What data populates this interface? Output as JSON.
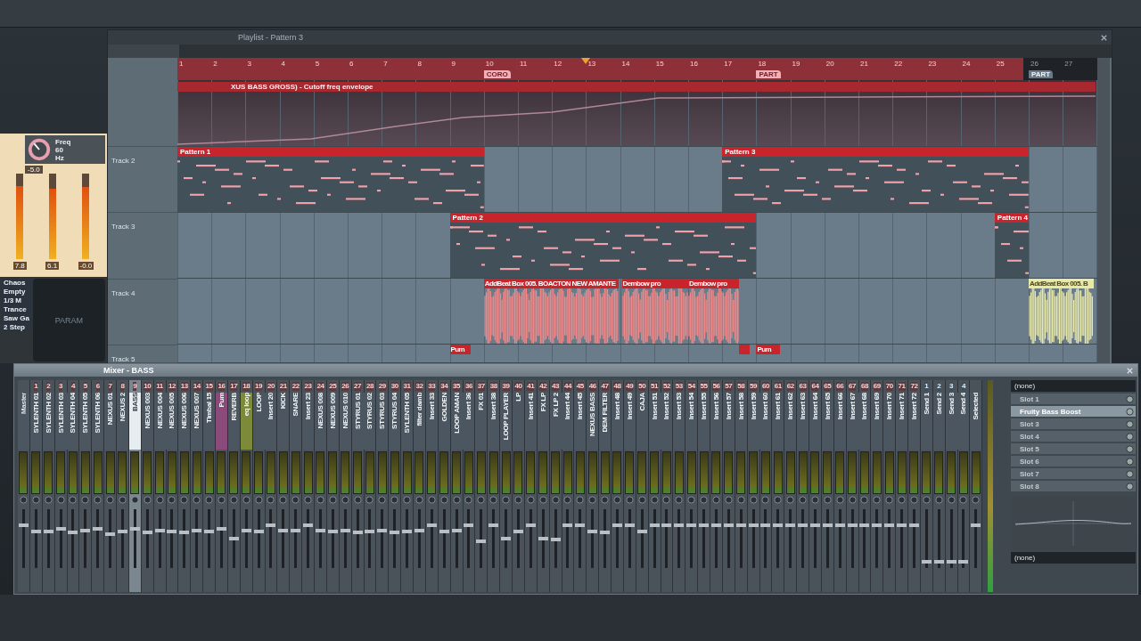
{
  "playlist": {
    "title": "Playlist - Pattern 3",
    "ruler": [
      {
        "label": "1",
        "in_song": true
      },
      {
        "label": "2",
        "in_song": true
      },
      {
        "label": "3",
        "in_song": true
      },
      {
        "label": "4",
        "in_song": true
      },
      {
        "label": "5",
        "in_song": true
      },
      {
        "label": "6",
        "in_song": true
      },
      {
        "label": "7",
        "in_song": true
      },
      {
        "label": "8",
        "in_song": true
      },
      {
        "label": "9",
        "in_song": true
      },
      {
        "label": "10",
        "in_song": true
      },
      {
        "label": "11",
        "in_song": true
      },
      {
        "label": "12",
        "in_song": true
      },
      {
        "label": "13",
        "in_song": true
      },
      {
        "label": "14",
        "in_song": true
      },
      {
        "label": "15",
        "in_song": true
      },
      {
        "label": "16",
        "in_song": true
      },
      {
        "label": "17",
        "in_song": true
      },
      {
        "label": "18",
        "in_song": true
      },
      {
        "label": "19",
        "in_song": true
      },
      {
        "label": "20",
        "in_song": true
      },
      {
        "label": "21",
        "in_song": true
      },
      {
        "label": "22",
        "in_song": true
      },
      {
        "label": "23",
        "in_song": true
      },
      {
        "label": "24",
        "in_song": true
      },
      {
        "label": "25",
        "in_song": true
      },
      {
        "label": "26",
        "in_song": false
      },
      {
        "label": "27",
        "in_song": false
      }
    ],
    "markers": [
      {
        "label": "CORO",
        "in_song": true
      },
      {
        "label": "PART",
        "in_song": true
      },
      {
        "label": "PART",
        "in_song": false
      }
    ],
    "automation": {
      "title": "XUS BASS GROSS) - Cutoff freq envelope"
    },
    "tracks": [
      {
        "name": "Track 2",
        "clips": [
          {
            "kind": "pattern",
            "title": "Pattern 1"
          },
          {
            "kind": "pattern",
            "title": "Pattern 3"
          }
        ]
      },
      {
        "name": "Track 3",
        "clips": [
          {
            "kind": "pattern",
            "title": "Pattern 2"
          },
          {
            "kind": "pattern",
            "title": "Pattern 4"
          }
        ]
      },
      {
        "name": "Track 4",
        "clips": [
          {
            "kind": "audio",
            "title": "AddBeat Box 005. BOACTON NEW AMANTE",
            "color": "#c8242c"
          },
          {
            "kind": "audio",
            "title": "Dembow pro",
            "color": "#c8242c"
          },
          {
            "kind": "audio",
            "title": "Dembow pro",
            "color": "#c8242c"
          },
          {
            "kind": "audio",
            "title": "AddBeat Box 005. B",
            "color": "#e8e8a8"
          }
        ]
      },
      {
        "name": "Track 5",
        "clips": [
          {
            "kind": "audio",
            "title": "Pum",
            "color": "#c8242c"
          },
          {
            "kind": "audio",
            "color": "#c8242c"
          },
          {
            "kind": "audio",
            "title": "Pum",
            "color": "#c8242c"
          }
        ]
      }
    ]
  },
  "plugin": {
    "knob_label": "Freq",
    "knob_value": "60",
    "knob_unit": "Hz",
    "readout": "-5.0",
    "meters": [
      {
        "value": "7.8",
        "level": 0.85
      },
      {
        "value": "6.1",
        "level": 0.82
      },
      {
        "value": "-0.0",
        "level": 0.84
      }
    ],
    "presets": [
      "Chaos",
      "Empty",
      "1/3 M",
      "Trance",
      "Saw Ga",
      "2 Step"
    ],
    "display": "PARAM"
  },
  "mixer": {
    "title": "Mixer - BASS",
    "strips": [
      {
        "kind": "master",
        "name": "Master",
        "selected": false,
        "color": "#4c5660",
        "level": 0.72
      },
      {
        "kind": "insert",
        "number": "1",
        "name": "SYLENTH 01",
        "selected": false,
        "color": "#4c5660",
        "level": 0.62
      },
      {
        "kind": "insert",
        "number": "2",
        "name": "SYLENTH 02",
        "selected": false,
        "color": "#4c5660",
        "level": 0.62
      },
      {
        "kind": "insert",
        "number": "3",
        "name": "SYLENTH 03",
        "selected": false,
        "color": "#4c5660",
        "level": 0.66
      },
      {
        "kind": "insert",
        "number": "4",
        "name": "SYLENTH 04",
        "selected": false,
        "color": "#4c5660",
        "level": 0.6
      },
      {
        "kind": "insert",
        "number": "5",
        "name": "SYLENTH 05",
        "selected": false,
        "color": "#4c5660",
        "level": 0.64
      },
      {
        "kind": "insert",
        "number": "6",
        "name": "SYLENTH 06",
        "selected": false,
        "color": "#4c5660",
        "level": 0.66
      },
      {
        "kind": "insert",
        "number": "7",
        "name": "NEXUS 01",
        "selected": false,
        "color": "#4c5660",
        "level": 0.58
      },
      {
        "kind": "insert",
        "number": "8",
        "name": "NEXUS 2",
        "selected": false,
        "color": "#4c5660",
        "level": 0.62
      },
      {
        "kind": "insert",
        "number": "9",
        "name": "BASS",
        "selected": true,
        "color": "#e6ecf0",
        "level": 0.66
      },
      {
        "kind": "insert",
        "number": "10",
        "name": "NEXUS 003",
        "selected": false,
        "color": "#4c5660",
        "level": 0.6
      },
      {
        "kind": "insert",
        "number": "11",
        "name": "NEXUS 004",
        "selected": false,
        "color": "#4c5660",
        "level": 0.64
      },
      {
        "kind": "insert",
        "number": "12",
        "name": "NEXUS 005",
        "selected": false,
        "color": "#4c5660",
        "level": 0.62
      },
      {
        "kind": "insert",
        "number": "13",
        "name": "NEXUS 006",
        "selected": false,
        "color": "#4c5660",
        "level": 0.6
      },
      {
        "kind": "insert",
        "number": "14",
        "name": "NEXUS 007",
        "selected": false,
        "color": "#4c5660",
        "level": 0.64
      },
      {
        "kind": "insert",
        "number": "15",
        "name": "Timbal 15",
        "selected": false,
        "color": "#4c5660",
        "level": 0.62
      },
      {
        "kind": "insert",
        "number": "16",
        "name": "Pum",
        "selected": false,
        "color": "#8a4a7a",
        "level": 0.66
      },
      {
        "kind": "insert",
        "number": "17",
        "name": "REVERB",
        "selected": false,
        "color": "#4c5660",
        "level": 0.5
      },
      {
        "kind": "insert",
        "number": "18",
        "name": "eq loop",
        "selected": false,
        "color": "#7c8a3a",
        "level": 0.64
      },
      {
        "kind": "insert",
        "number": "19",
        "name": "LOOP",
        "selected": false,
        "color": "#4c5660",
        "level": 0.62
      },
      {
        "kind": "insert",
        "number": "20",
        "name": "Insert 20",
        "selected": false,
        "color": "#4c5660",
        "level": 0.72
      },
      {
        "kind": "insert",
        "number": "21",
        "name": "KICK",
        "selected": false,
        "color": "#4c5660",
        "level": 0.64
      },
      {
        "kind": "insert",
        "number": "22",
        "name": "SNARE",
        "selected": false,
        "color": "#4c5660",
        "level": 0.64
      },
      {
        "kind": "insert",
        "number": "23",
        "name": "Insert 23",
        "selected": false,
        "color": "#4c5660",
        "level": 0.72
      },
      {
        "kind": "insert",
        "number": "24",
        "name": "NEXUS 008",
        "selected": false,
        "color": "#4c5660",
        "level": 0.64
      },
      {
        "kind": "insert",
        "number": "25",
        "name": "NEXUS 009",
        "selected": false,
        "color": "#4c5660",
        "level": 0.62
      },
      {
        "kind": "insert",
        "number": "26",
        "name": "NEXUS 010",
        "selected": false,
        "color": "#4c5660",
        "level": 0.64
      },
      {
        "kind": "insert",
        "number": "27",
        "name": "STYRUS 01",
        "selected": false,
        "color": "#4c5660",
        "level": 0.6
      },
      {
        "kind": "insert",
        "number": "28",
        "name": "STYRUS 02",
        "selected": false,
        "color": "#4c5660",
        "level": 0.62
      },
      {
        "kind": "insert",
        "number": "29",
        "name": "STYRUS 03",
        "selected": false,
        "color": "#4c5660",
        "level": 0.64
      },
      {
        "kind": "insert",
        "number": "30",
        "name": "STYRUS 04",
        "selected": false,
        "color": "#4c5660",
        "level": 0.6
      },
      {
        "kind": "insert",
        "number": "31",
        "name": "SYLENTH 05",
        "selected": false,
        "color": "#4c5660",
        "level": 0.62
      },
      {
        "kind": "insert",
        "number": "32",
        "name": "filter damb",
        "selected": false,
        "color": "#4c5660",
        "level": 0.64
      },
      {
        "kind": "insert",
        "number": "33",
        "name": "Insert 33",
        "selected": false,
        "color": "#4c5660",
        "level": 0.72
      },
      {
        "kind": "insert",
        "number": "34",
        "name": "GOLDEN",
        "selected": false,
        "color": "#4c5660",
        "level": 0.62
      },
      {
        "kind": "insert",
        "number": "35",
        "name": "LOOP AMAN",
        "selected": false,
        "color": "#4c5660",
        "level": 0.64
      },
      {
        "kind": "insert",
        "number": "36",
        "name": "Insert 36",
        "selected": false,
        "color": "#4c5660",
        "level": 0.72
      },
      {
        "kind": "insert",
        "number": "37",
        "name": "FX 01",
        "selected": false,
        "color": "#4c5660",
        "level": 0.46
      },
      {
        "kind": "insert",
        "number": "38",
        "name": "Insert 38",
        "selected": false,
        "color": "#4c5660",
        "level": 0.72
      },
      {
        "kind": "insert",
        "number": "39",
        "name": "LOOP PLAYER",
        "selected": false,
        "color": "#4c5660",
        "level": 0.5
      },
      {
        "kind": "insert",
        "number": "40",
        "name": "LP",
        "selected": false,
        "color": "#4c5660",
        "level": 0.62
      },
      {
        "kind": "insert",
        "number": "41",
        "name": "Insert 41",
        "selected": false,
        "color": "#4c5660",
        "level": 0.72
      },
      {
        "kind": "insert",
        "number": "42",
        "name": "FX LP",
        "selected": false,
        "color": "#4c5660",
        "level": 0.5
      },
      {
        "kind": "insert",
        "number": "43",
        "name": "FX LP 2",
        "selected": false,
        "color": "#4c5660",
        "level": 0.48
      },
      {
        "kind": "insert",
        "number": "44",
        "name": "Insert 44",
        "selected": false,
        "color": "#4c5660",
        "level": 0.72
      },
      {
        "kind": "insert",
        "number": "45",
        "name": "Insert 45",
        "selected": false,
        "color": "#4c5660",
        "level": 0.72
      },
      {
        "kind": "insert",
        "number": "46",
        "name": "NEXUS BASS",
        "selected": false,
        "color": "#4c5660",
        "level": 0.62
      },
      {
        "kind": "insert",
        "number": "47",
        "name": "DEM FILTER",
        "selected": false,
        "color": "#4c5660",
        "level": 0.6
      },
      {
        "kind": "insert",
        "number": "48",
        "name": "Insert 48",
        "selected": false,
        "color": "#4c5660",
        "level": 0.72
      },
      {
        "kind": "insert",
        "number": "49",
        "name": "Insert 49",
        "selected": false,
        "color": "#4c5660",
        "level": 0.72
      },
      {
        "kind": "insert",
        "number": "50",
        "name": "CAJA",
        "selected": false,
        "color": "#4c5660",
        "level": 0.62
      },
      {
        "kind": "insert",
        "number": "51",
        "name": "Insert 51",
        "selected": false,
        "color": "#4c5660",
        "level": 0.72
      },
      {
        "kind": "insert",
        "number": "52",
        "name": "Insert 52",
        "selected": false,
        "color": "#4c5660",
        "level": 0.72
      },
      {
        "kind": "insert",
        "number": "53",
        "name": "Insert 53",
        "selected": false,
        "color": "#4c5660",
        "level": 0.72
      },
      {
        "kind": "insert",
        "number": "54",
        "name": "Insert 54",
        "selected": false,
        "color": "#4c5660",
        "level": 0.72
      },
      {
        "kind": "insert",
        "number": "55",
        "name": "Insert 55",
        "selected": false,
        "color": "#4c5660",
        "level": 0.72
      },
      {
        "kind": "insert",
        "number": "56",
        "name": "Insert 56",
        "selected": false,
        "color": "#4c5660",
        "level": 0.72
      },
      {
        "kind": "insert",
        "number": "57",
        "name": "Insert 57",
        "selected": false,
        "color": "#4c5660",
        "level": 0.72
      },
      {
        "kind": "insert",
        "number": "58",
        "name": "Insert 58",
        "selected": false,
        "color": "#4c5660",
        "level": 0.72
      },
      {
        "kind": "insert",
        "number": "59",
        "name": "Insert 59",
        "selected": false,
        "color": "#4c5660",
        "level": 0.72
      },
      {
        "kind": "insert",
        "number": "60",
        "name": "Insert 60",
        "selected": false,
        "color": "#4c5660",
        "level": 0.72
      },
      {
        "kind": "insert",
        "number": "61",
        "name": "Insert 61",
        "selected": false,
        "color": "#4c5660",
        "level": 0.72
      },
      {
        "kind": "insert",
        "number": "62",
        "name": "Insert 62",
        "selected": false,
        "color": "#4c5660",
        "level": 0.72
      },
      {
        "kind": "insert",
        "number": "63",
        "name": "Insert 63",
        "selected": false,
        "color": "#4c5660",
        "level": 0.72
      },
      {
        "kind": "insert",
        "number": "64",
        "name": "Insert 64",
        "selected": false,
        "color": "#4c5660",
        "level": 0.72
      },
      {
        "kind": "insert",
        "number": "65",
        "name": "Insert 65",
        "selected": false,
        "color": "#4c5660",
        "level": 0.72
      },
      {
        "kind": "insert",
        "number": "66",
        "name": "Insert 66",
        "selected": false,
        "color": "#4c5660",
        "level": 0.72
      },
      {
        "kind": "insert",
        "number": "67",
        "name": "Insert 67",
        "selected": false,
        "color": "#4c5660",
        "level": 0.72
      },
      {
        "kind": "insert",
        "number": "68",
        "name": "Insert 68",
        "selected": false,
        "color": "#4c5660",
        "level": 0.72
      },
      {
        "kind": "insert",
        "number": "69",
        "name": "Insert 69",
        "selected": false,
        "color": "#4c5660",
        "level": 0.72
      },
      {
        "kind": "insert",
        "number": "70",
        "name": "Insert 70",
        "selected": false,
        "color": "#4c5660",
        "level": 0.72
      },
      {
        "kind": "insert",
        "number": "71",
        "name": "Insert 71",
        "selected": false,
        "color": "#4c5660",
        "level": 0.72
      },
      {
        "kind": "insert",
        "number": "72",
        "name": "Insert 72",
        "selected": false,
        "color": "#4c5660",
        "level": 0.72
      },
      {
        "kind": "send",
        "number": "1",
        "name": "Send 1",
        "selected": false,
        "color": "#4c5660",
        "level": 0.1
      },
      {
        "kind": "send",
        "number": "2",
        "name": "Send 2",
        "selected": false,
        "color": "#4c5660",
        "level": 0.1
      },
      {
        "kind": "send",
        "number": "3",
        "name": "Send 3",
        "selected": false,
        "color": "#4c5660",
        "level": 0.1
      },
      {
        "kind": "send",
        "number": "4",
        "name": "Send 4",
        "selected": false,
        "color": "#4c5660",
        "level": 0.1
      },
      {
        "kind": "current",
        "name": "Selected",
        "selected": false,
        "color": "#4c5660",
        "level": 0.72
      }
    ],
    "input": "(none)",
    "slots": [
      {
        "name": "Slot 1",
        "selected": false
      },
      {
        "name": "Fruity Bass Boost",
        "selected": true
      },
      {
        "name": "Slot 3",
        "selected": false
      },
      {
        "name": "Slot 4",
        "selected": false
      },
      {
        "name": "Slot 5",
        "selected": false
      },
      {
        "name": "Slot 6",
        "selected": false
      },
      {
        "name": "Slot 7",
        "selected": false
      },
      {
        "name": "Slot 8",
        "selected": false
      }
    ],
    "output": "(none)"
  }
}
